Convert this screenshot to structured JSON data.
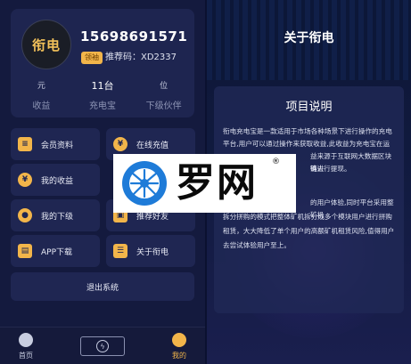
{
  "profile": {
    "avatar_text": "衔电",
    "phone": "15698691571",
    "badge": "领袖",
    "referral": "推荐码：XD2337"
  },
  "stats": [
    {
      "value": "元",
      "label": "收益"
    },
    {
      "value": "11台",
      "label": "充电宝"
    },
    {
      "value": "位",
      "label": "下级伙伴"
    }
  ],
  "menu": [
    {
      "label": "会员资料",
      "icon": "user-card-icon"
    },
    {
      "label": "在线充值",
      "icon": "yen-coin-icon"
    },
    {
      "label": "我的收益",
      "icon": "yen-coin-icon"
    },
    {
      "label": "我的下级",
      "icon": "people-icon"
    },
    {
      "label": "推荐好友",
      "icon": "gift-icon"
    },
    {
      "label": "APP下载",
      "icon": "download-icon"
    },
    {
      "label": "关于衔电",
      "icon": "document-icon"
    }
  ],
  "logout_label": "退出系统",
  "tabbar": {
    "home_label": "首页",
    "mine_label": "我的"
  },
  "about": {
    "title": "关于衔电",
    "section_title": "项目说明",
    "paragraph1_lines": [
      "衔电充电宝是一款适用于市场各种场景下进行操作的充电",
      "平台,用户可以通过操作来获取收益,此收益为充电宝在运",
      "益来源于互联网大数据区块链去",
      "确进行提现。"
    ],
    "paragraph2_lines": [
      "的用户体验,同时平台采用整矿机",
      "拆分拼购的模式把整体矿机拆分成多个模块用户进行拼购",
      "租赁，大大降低了单个用户的高额矿机租赁风险,值得用户",
      "去尝试体验用户至上。"
    ]
  },
  "watermark": {
    "text": "罗网",
    "mark": "®"
  },
  "colors": {
    "accent": "#f2b54a",
    "panel_bg": "#141a3e",
    "card_bg": "#1f2652"
  }
}
